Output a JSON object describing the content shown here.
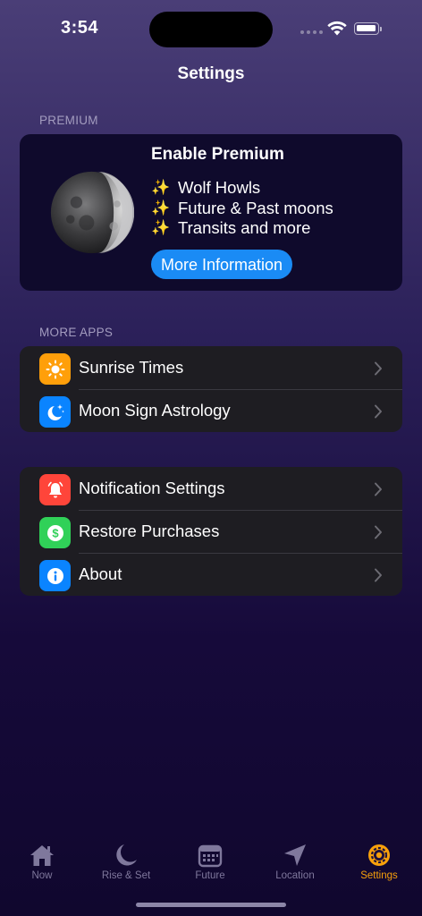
{
  "status_bar": {
    "time": "3:54"
  },
  "header": {
    "title": "Settings"
  },
  "premium": {
    "section_label": "PREMIUM",
    "title": "Enable Premium",
    "features": [
      "Wolf Howls",
      "Future & Past moons",
      "Transits and more"
    ],
    "sparkle": "✨",
    "button_label": "More Information"
  },
  "more_apps": {
    "section_label": "MORE APPS",
    "items": [
      {
        "label": "Sunrise Times",
        "icon": "sun-icon",
        "color": "#ff9f0a"
      },
      {
        "label": "Moon Sign Astrology",
        "icon": "moon-stars-icon",
        "color": "#0a84ff"
      }
    ]
  },
  "settings_list": {
    "items": [
      {
        "label": "Notification Settings",
        "icon": "bell-icon",
        "color": "#ff453a"
      },
      {
        "label": "Restore Purchases",
        "icon": "dollar-icon",
        "color": "#30d158"
      },
      {
        "label": "About",
        "icon": "info-icon",
        "color": "#0a84ff"
      }
    ]
  },
  "tab_bar": {
    "active_color": "#f7a00b",
    "tabs": [
      {
        "label": "Now",
        "icon": "house-icon"
      },
      {
        "label": "Rise & Set",
        "icon": "crescent-moon-icon"
      },
      {
        "label": "Future",
        "icon": "calendar-icon"
      },
      {
        "label": "Location",
        "icon": "location-arrow-icon"
      },
      {
        "label": "Settings",
        "icon": "gear-icon",
        "active": true
      }
    ]
  }
}
